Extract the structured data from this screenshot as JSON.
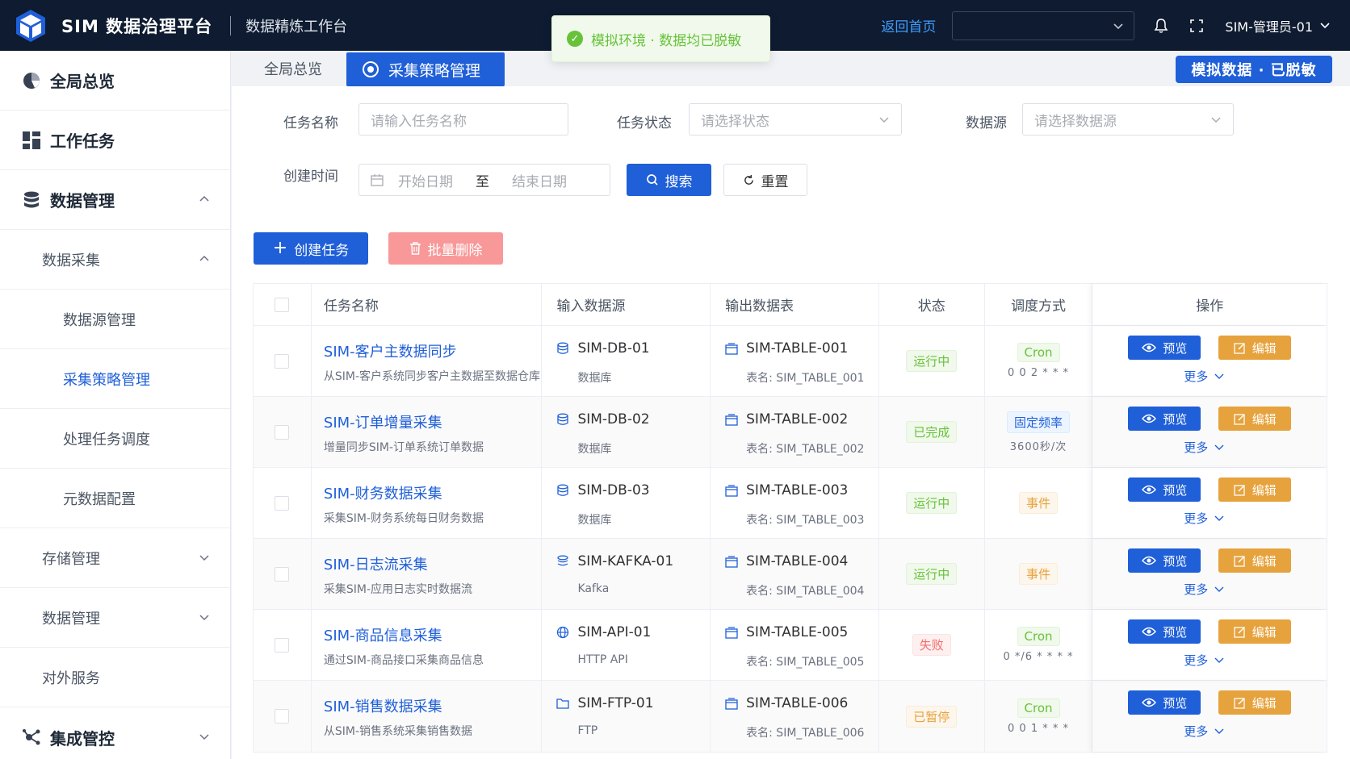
{
  "header": {
    "brand": "SIM 数据治理平台",
    "workbench": "数据精炼工作台",
    "home_link": "返回首页",
    "user": "SIM-管理员-01"
  },
  "toast": {
    "text": "模拟环境 · 数据均已脱敏"
  },
  "sidebar": {
    "items": [
      {
        "label": "全局总览",
        "level": 1,
        "icon": "pie-chart-icon"
      },
      {
        "label": "工作任务",
        "level": 1,
        "icon": "dashboard-icon"
      },
      {
        "label": "数据管理",
        "level": 1,
        "icon": "database-icon",
        "expanded": true
      },
      {
        "label": "数据采集",
        "level": 2,
        "expanded": true
      },
      {
        "label": "数据源管理",
        "level": 3
      },
      {
        "label": "采集策略管理",
        "level": 3,
        "active": true
      },
      {
        "label": "处理任务调度",
        "level": 3
      },
      {
        "label": "元数据配置",
        "level": 3
      },
      {
        "label": "存储管理",
        "level": 2
      },
      {
        "label": "数据管理",
        "level": 2
      },
      {
        "label": "对外服务",
        "level": 2
      },
      {
        "label": "集成管控",
        "level": 1,
        "icon": "network-icon"
      }
    ]
  },
  "tabs": {
    "overview": "全局总览",
    "active": "采集策略管理",
    "badge": "模拟数据 · 已脱敏"
  },
  "filters": {
    "task_name_label": "任务名称",
    "task_name_placeholder": "请输入任务名称",
    "status_label": "任务状态",
    "status_placeholder": "请选择状态",
    "source_label": "数据源",
    "source_placeholder": "请选择数据源",
    "created_label": "创建时间",
    "start_placeholder": "开始日期",
    "to": "至",
    "end_placeholder": "结束日期",
    "search": "搜索",
    "reset": "重置"
  },
  "actions": {
    "create": "创建任务",
    "batch_delete": "批量删除"
  },
  "table": {
    "columns": [
      "任务名称",
      "输入数据源",
      "输出数据表",
      "状态",
      "调度方式",
      "操作"
    ],
    "preview": "预览",
    "edit": "编辑",
    "more": "更多",
    "rows": [
      {
        "name": "SIM-客户主数据同步",
        "desc": "从SIM-客户系统同步客户主数据至数据仓库",
        "source": "SIM-DB-01",
        "source_type": "数据库",
        "source_icon": "database-icon",
        "table": "SIM-TABLE-001",
        "table_sub": "表名: SIM_TABLE_001",
        "status": "运行中",
        "status_color": "green",
        "sched": "Cron",
        "sched_color": "green",
        "sched_sub": "0 0 2 * * *"
      },
      {
        "name": "SIM-订单增量采集",
        "desc": "增量同步SIM-订单系统订单数据",
        "source": "SIM-DB-02",
        "source_type": "数据库",
        "source_icon": "database-icon",
        "table": "SIM-TABLE-002",
        "table_sub": "表名: SIM_TABLE_002",
        "status": "已完成",
        "status_color": "green",
        "sched": "固定频率",
        "sched_color": "blue",
        "sched_sub": "3600秒/次"
      },
      {
        "name": "SIM-财务数据采集",
        "desc": "采集SIM-财务系统每日财务数据",
        "source": "SIM-DB-03",
        "source_type": "数据库",
        "source_icon": "database-icon",
        "table": "SIM-TABLE-003",
        "table_sub": "表名: SIM_TABLE_003",
        "status": "运行中",
        "status_color": "green",
        "sched": "事件",
        "sched_color": "orange",
        "sched_sub": ""
      },
      {
        "name": "SIM-日志流采集",
        "desc": "采集SIM-应用日志实时数据流",
        "source": "SIM-KAFKA-01",
        "source_type": "Kafka",
        "source_icon": "stream-icon",
        "table": "SIM-TABLE-004",
        "table_sub": "表名: SIM_TABLE_004",
        "status": "运行中",
        "status_color": "green",
        "sched": "事件",
        "sched_color": "orange",
        "sched_sub": ""
      },
      {
        "name": "SIM-商品信息采集",
        "desc": "通过SIM-商品接口采集商品信息",
        "source": "SIM-API-01",
        "source_type": "HTTP API",
        "source_icon": "globe-icon",
        "table": "SIM-TABLE-005",
        "table_sub": "表名: SIM_TABLE_005",
        "status": "失败",
        "status_color": "red",
        "sched": "Cron",
        "sched_color": "green",
        "sched_sub": "0 */6 * * * *"
      },
      {
        "name": "SIM-销售数据采集",
        "desc": "从SIM-销售系统采集销售数据",
        "source": "SIM-FTP-01",
        "source_type": "FTP",
        "source_icon": "folder-icon",
        "table": "SIM-TABLE-006",
        "table_sub": "表名: SIM_TABLE_006",
        "status": "已暂停",
        "status_color": "orange",
        "sched": "Cron",
        "sched_color": "green",
        "sched_sub": "0 0 1 * * *"
      }
    ]
  }
}
